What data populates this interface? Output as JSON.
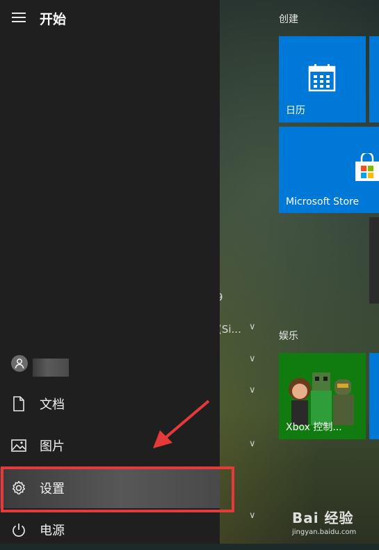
{
  "start_menu": {
    "title": "开始",
    "items": [
      {
        "label": "文档",
        "icon": "document-icon"
      },
      {
        "label": "图片",
        "icon": "pictures-icon"
      },
      {
        "label": "设置",
        "icon": "gear-icon"
      },
      {
        "label": "电源",
        "icon": "power-icon"
      }
    ],
    "selected": "设置"
  },
  "app_list_peek": {
    "fragment_1": "9",
    "fragment_2": "(Si..."
  },
  "tiles": {
    "group_create": "创建",
    "group_entertainment": "娱乐",
    "calendar_label": "日历",
    "store_label": "Microsoft Store",
    "xbox_label": "Xbox 控制..."
  },
  "watermark": {
    "brand": "Bai 经验",
    "url": "jingyan.baidu.com"
  },
  "colors": {
    "panel_bg": "#1f1f1f",
    "tile_blue": "#0078d7",
    "xbox_green": "#107c10",
    "highlight_red": "#e63a3a"
  }
}
